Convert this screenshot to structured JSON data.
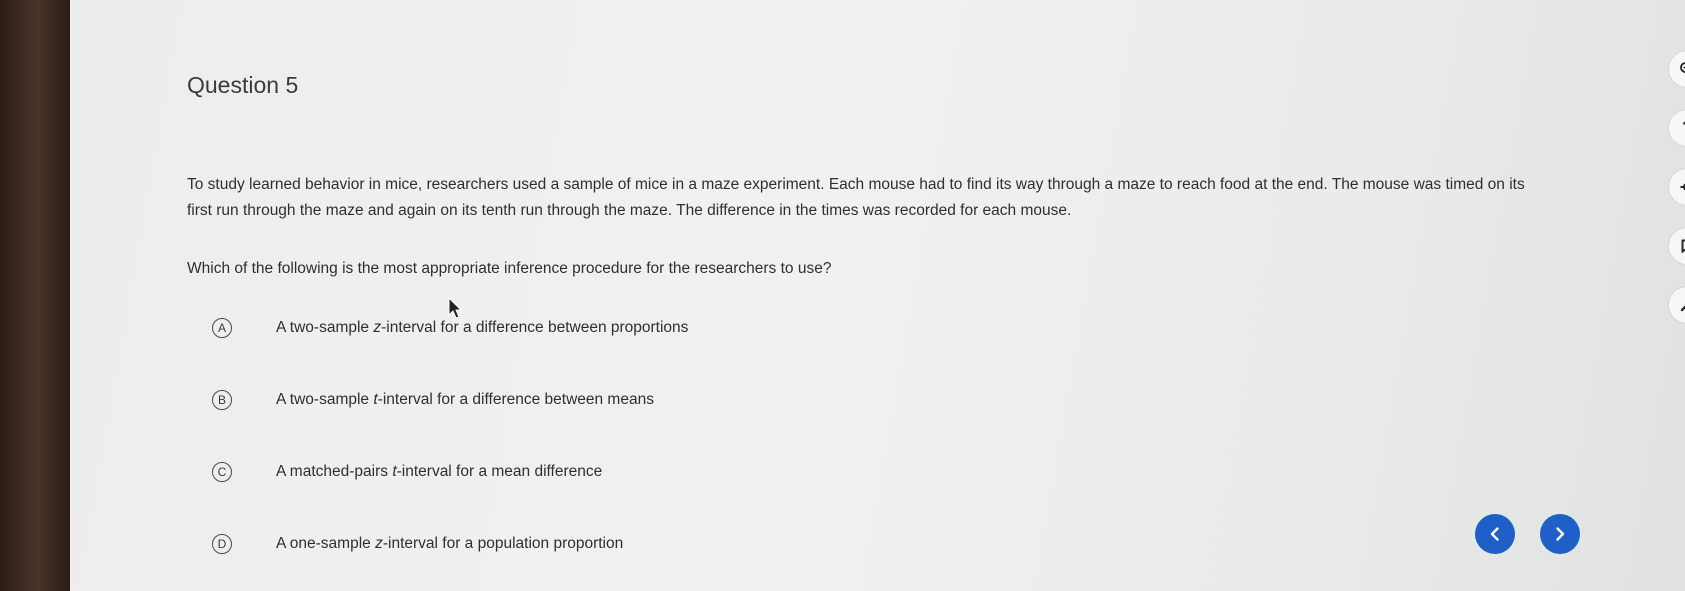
{
  "question": {
    "title": "Question 5",
    "stem_line1": "To study learned behavior in mice, researchers used a sample of mice in a maze experiment. Each mouse had to find its way through a maze to reach food at the end. The mouse was timed on its",
    "stem_line2": "first run through the maze and again on its tenth run through the maze. The difference in the times was recorded for each mouse.",
    "prompt": "Which of the following is the most appropriate inference procedure for the researchers to use?"
  },
  "choices": [
    {
      "letter": "A",
      "before": "A two-sample ",
      "var": "z",
      "after": "-interval for a difference between proportions"
    },
    {
      "letter": "B",
      "before": "A two-sample ",
      "var": "t",
      "after": "-interval for a difference between means"
    },
    {
      "letter": "C",
      "before": "A matched-pairs ",
      "var": "t",
      "after": "-interval for a mean difference"
    },
    {
      "letter": "D",
      "before": "A one-sample ",
      "var": "z",
      "after": "-interval for a population proportion"
    }
  ],
  "tools": {
    "zoom_icon": "magnifier-icon",
    "help_label": "?",
    "settings_icon": "gear-icon",
    "bookmark_icon": "bookmark-icon",
    "annotate_icon": "pencil-icon"
  },
  "navigation": {
    "prev_icon": "chevron-left-icon",
    "next_icon": "chevron-right-icon",
    "accent": "#1f5fc8"
  }
}
